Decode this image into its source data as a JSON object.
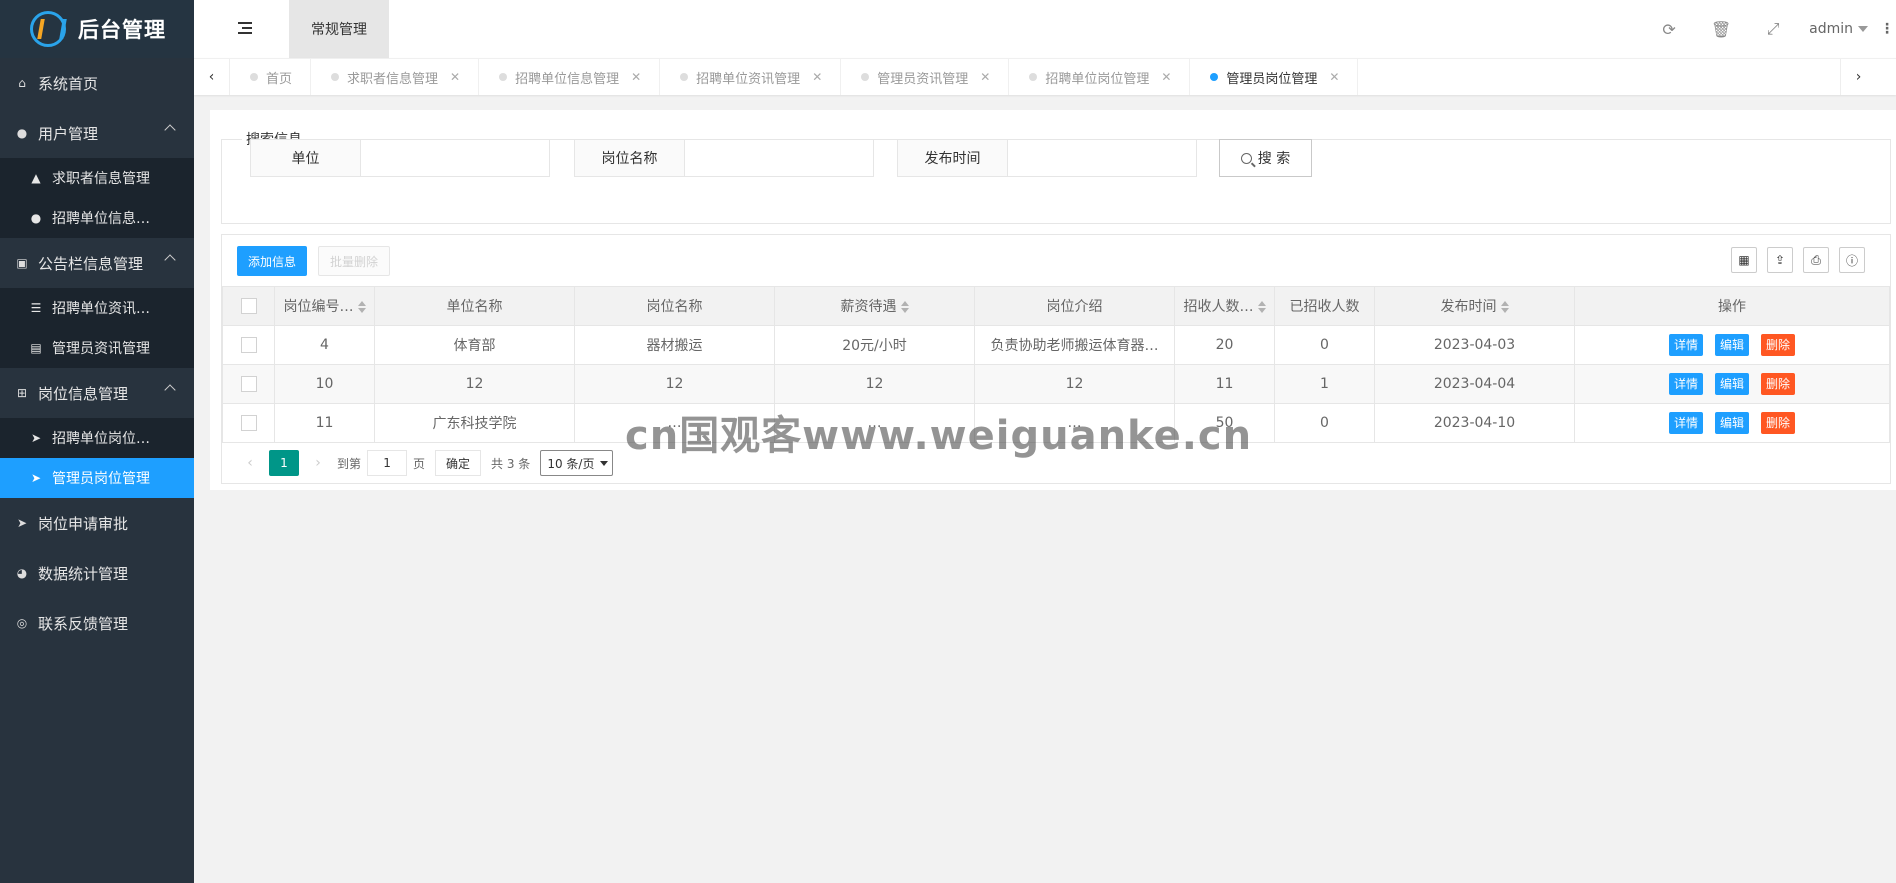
{
  "app": {
    "title": "后台管理"
  },
  "sidebar": {
    "groups": [
      {
        "label": "系统首页",
        "icon": "home-icon"
      },
      {
        "label": "用户管理",
        "icon": "users-icon",
        "expanded": true,
        "items": [
          {
            "label": "求职者信息管理",
            "icon": "graduation-cap-icon"
          },
          {
            "label": "招聘单位信息…",
            "icon": "user-icon"
          }
        ]
      },
      {
        "label": "公告栏信息管理",
        "icon": "calendar-icon",
        "expanded": true,
        "items": [
          {
            "label": "招聘单位资讯…",
            "icon": "list-icon"
          },
          {
            "label": "管理员资讯管理",
            "icon": "id-card-icon"
          }
        ]
      },
      {
        "label": "岗位信息管理",
        "icon": "sitemap-icon",
        "expanded": true,
        "items": [
          {
            "label": "招聘单位岗位…",
            "icon": "paper-plane-icon"
          },
          {
            "label": "管理员岗位管理",
            "icon": "paper-plane-icon",
            "active": true
          }
        ]
      },
      {
        "label": "岗位申请审批",
        "icon": "paper-plane-icon"
      },
      {
        "label": "数据统计管理",
        "icon": "pie-chart-icon"
      },
      {
        "label": "联系反馈管理",
        "icon": "comments-icon"
      }
    ]
  },
  "header": {
    "active_tab": "常规管理",
    "user": "admin"
  },
  "tabs": [
    {
      "label": "首页",
      "closable": false,
      "active": false
    },
    {
      "label": "求职者信息管理",
      "closable": true,
      "active": false
    },
    {
      "label": "招聘单位信息管理",
      "closable": true,
      "active": false
    },
    {
      "label": "招聘单位资讯管理",
      "closable": true,
      "active": false
    },
    {
      "label": "管理员资讯管理",
      "closable": true,
      "active": false
    },
    {
      "label": "招聘单位岗位管理",
      "closable": true,
      "active": false
    },
    {
      "label": "管理员岗位管理",
      "closable": true,
      "active": true
    }
  ],
  "search": {
    "legend": "搜索信息",
    "fields": [
      {
        "label": "单位",
        "value": ""
      },
      {
        "label": "岗位名称",
        "value": ""
      },
      {
        "label": "发布时间",
        "value": ""
      }
    ],
    "button": "搜 索"
  },
  "toolbar": {
    "add": "添加信息",
    "batch_delete": "批量删除"
  },
  "table": {
    "columns": [
      "岗位编号…",
      "单位名称",
      "岗位名称",
      "薪资待遇",
      "岗位介绍",
      "招收人数…",
      "已招收人数",
      "发布时间",
      "操作"
    ],
    "rows": [
      [
        "4",
        "体育部",
        "器材搬运",
        "20元/小时",
        "负责协助老师搬运体育器…",
        "20",
        "0",
        "2023-04-03"
      ],
      [
        "10",
        "12",
        "12",
        "12",
        "12",
        "11",
        "1",
        "2023-04-04"
      ],
      [
        "11",
        "广东科技学院",
        "…",
        "…",
        "…",
        "50",
        "0",
        "2023-04-10"
      ]
    ],
    "actions": {
      "detail": "详情",
      "edit": "编辑",
      "delete": "删除"
    }
  },
  "pager": {
    "current": "1",
    "goto_prefix": "到第",
    "goto_value": "1",
    "goto_suffix": "页",
    "confirm": "确定",
    "total": "共 3 条",
    "page_size": "10 条/页"
  },
  "watermark": "cn国观客www.weiguanke.cn",
  "colors": {
    "primary": "#1e9fff",
    "danger": "#ff5722",
    "pager_active": "#009688",
    "sidebar": "#28333e"
  }
}
